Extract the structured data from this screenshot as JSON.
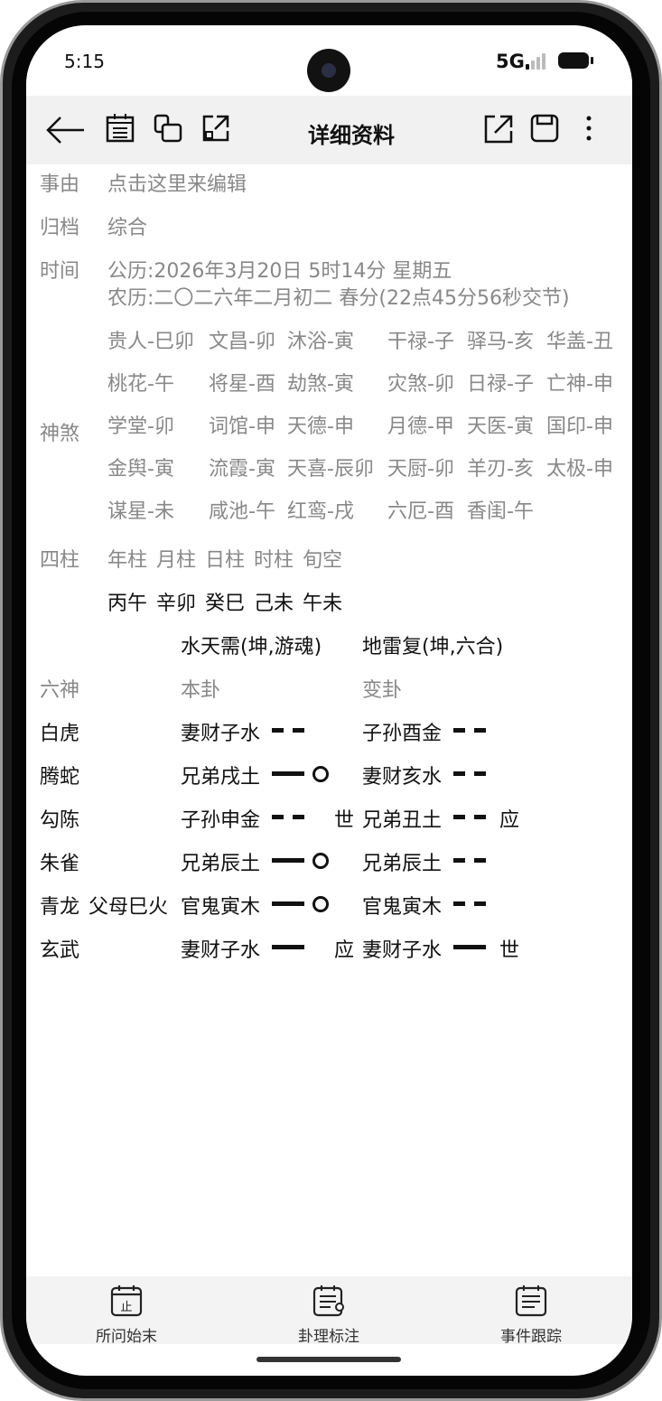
{
  "status": {
    "time": "5:15",
    "network": "5G"
  },
  "toolbar": {
    "title": "详细资料"
  },
  "fields": {
    "reason": {
      "label": "事由",
      "value": "点击这里来编辑"
    },
    "archive": {
      "label": "归档",
      "value": "综合"
    },
    "time": {
      "label": "时间",
      "solar": "公历:2026年3月20日   5时14分  星期五",
      "lunar": "农历:二〇二六年二月初二 春分(22点45分56秒交节)"
    }
  },
  "shensha": {
    "label": "神煞",
    "rows": [
      [
        "贵人-巳卯",
        "文昌-卯",
        "沐浴-寅",
        "干禄-子",
        "驿马-亥",
        "华盖-丑"
      ],
      [
        "桃花-午",
        "将星-酉",
        "劫煞-寅",
        "灾煞-卯",
        "日禄-子",
        "亡神-申"
      ],
      [
        "学堂-卯",
        "词馆-申",
        "天德-申",
        "月德-甲",
        "天医-寅",
        "国印-申"
      ],
      [
        "金舆-寅",
        "流霞-寅",
        "天喜-辰卯",
        "天厨-卯",
        "羊刃-亥",
        "太极-申"
      ],
      [
        "谋星-未",
        "咸池-午",
        "红鸾-戌",
        "六厄-酉",
        "香闺-午"
      ]
    ]
  },
  "sizhu": {
    "label": "四柱",
    "headers": [
      "年柱",
      "月柱",
      "日柱",
      "时柱",
      "旬空"
    ],
    "values": [
      "丙午",
      "辛卯",
      "癸巳",
      "己未",
      "午未"
    ]
  },
  "gua": {
    "ben_name": "水天需(坤,游魂)",
    "bian_name": "地雷复(坤,六合)",
    "col_liushen": "六神",
    "col_ben": "本卦",
    "col_bian": "变卦",
    "rows": [
      {
        "god": "白虎",
        "fu": "",
        "ben": "妻财子水",
        "ben_line": "yin",
        "moving": false,
        "ben_mark": "",
        "bian": "子孙酉金",
        "bian_line": "yin",
        "bian_mark": ""
      },
      {
        "god": "腾蛇",
        "fu": "",
        "ben": "兄弟戌土",
        "ben_line": "yang",
        "moving": true,
        "ben_mark": "",
        "bian": "妻财亥水",
        "bian_line": "yin",
        "bian_mark": ""
      },
      {
        "god": "勾陈",
        "fu": "",
        "ben": "子孙申金",
        "ben_line": "yin",
        "moving": false,
        "ben_mark": "世",
        "bian": "兄弟丑土",
        "bian_line": "yin",
        "bian_mark": "应"
      },
      {
        "god": "朱雀",
        "fu": "",
        "ben": "兄弟辰土",
        "ben_line": "yang",
        "moving": true,
        "ben_mark": "",
        "bian": "兄弟辰土",
        "bian_line": "yin",
        "bian_mark": ""
      },
      {
        "god": "青龙",
        "fu": "父母巳火",
        "ben": "官鬼寅木",
        "ben_line": "yang",
        "moving": true,
        "ben_mark": "",
        "bian": "官鬼寅木",
        "bian_line": "yin",
        "bian_mark": ""
      },
      {
        "god": "玄武",
        "fu": "",
        "ben": "妻财子水",
        "ben_line": "yang",
        "moving": false,
        "ben_mark": "应",
        "bian": "妻财子水",
        "bian_line": "yang",
        "bian_mark": "世"
      }
    ]
  },
  "bottom": [
    "所问始末",
    "卦理标注",
    "事件跟踪"
  ]
}
